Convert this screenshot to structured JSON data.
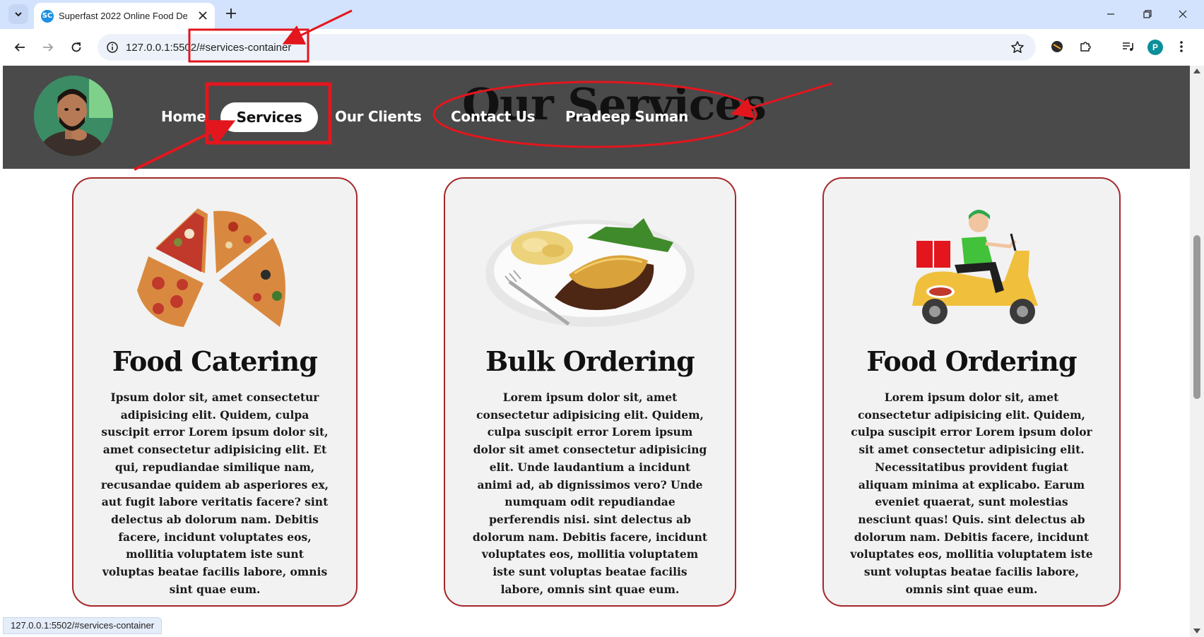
{
  "browser": {
    "tab": {
      "title": "Superfast 2022 Online Food De",
      "favicon_text": "SC",
      "favicon_icon": "site-favicon-icon"
    },
    "url": "127.0.0.1:5502/#services-container",
    "profile_initial": "P",
    "status_url": "127.0.0.1:5502/#services-container"
  },
  "header": {
    "nav": {
      "home": "Home",
      "services": "Services",
      "clients": "Our Clients",
      "contact": "Contact Us",
      "author": "Pradeep Suman"
    },
    "section_title": "Our Services"
  },
  "services": [
    {
      "title": "Food Catering",
      "image_icon": "pizza-slices-image",
      "text": "Ipsum dolor sit, amet consectetur adipisicing elit. Quidem, culpa suscipit error Lorem ipsum dolor sit, amet consectetur adipisicing elit. Et qui, repudiandae similique nam, recusandae quidem ab asperiores ex, aut fugit labore veritatis facere? sint delectus ab dolorum nam. Debitis facere, incidunt voluptates eos, mollitia voluptatem iste sunt voluptas beatae facilis labore, omnis sint quae eum."
    },
    {
      "title": "Bulk Ordering",
      "image_icon": "food-plate-image",
      "text": "Lorem ipsum dolor sit, amet consectetur adipisicing elit. Quidem, culpa suscipit error Lorem ipsum dolor sit amet consectetur adipisicing elit. Unde laudantium a incidunt animi ad, ab dignissimos vero? Unde numquam odit repudiandae perferendis nisi. sint delectus ab dolorum nam. Debitis facere, incidunt voluptates eos, mollitia voluptatem iste sunt voluptas beatae facilis labore, omnis sint quae eum."
    },
    {
      "title": "Food Ordering",
      "image_icon": "delivery-scooter-image",
      "text": "Lorem ipsum dolor sit, amet consectetur adipisicing elit. Quidem, culpa suscipit error Lorem ipsum dolor sit amet consectetur adipisicing elit. Necessitatibus provident fugiat aliquam minima at explicabo. Earum eveniet quaerat, sunt molestias nesciunt quas! Quis. sint delectus ab dolorum nam. Debitis facere, incidunt voluptates eos, mollitia voluptatem iste sunt voluptas beatae facilis labore, omnis sint quae eum."
    }
  ],
  "colors": {
    "header_bg": "#4a4a4a",
    "card_border": "#a5282c",
    "card_bg": "#f2f2f2",
    "annotation_red": "#e3161d",
    "tabbar_bg": "#d3e3fd"
  }
}
